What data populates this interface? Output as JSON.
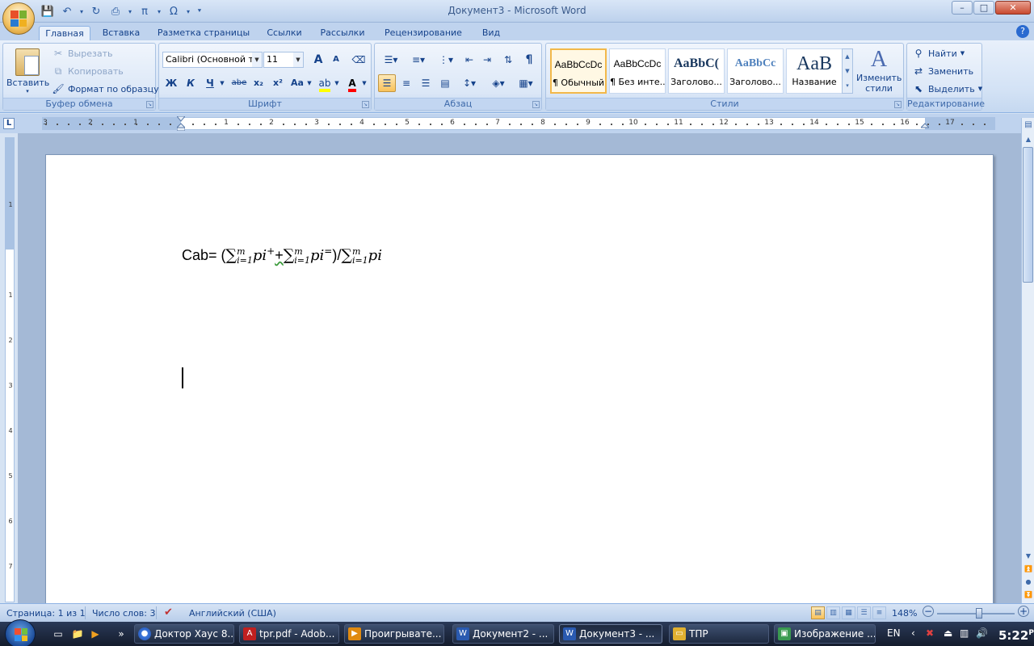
{
  "window": {
    "title": "Документ3 - Microsoft Word",
    "minimize": "–",
    "maximize": "□",
    "close": "✕"
  },
  "tabs": [
    "Главная",
    "Вставка",
    "Разметка страницы",
    "Ссылки",
    "Рассылки",
    "Рецензирование",
    "Вид"
  ],
  "active_tab": "Главная",
  "ribbon": {
    "clipboard": {
      "label": "Буфер обмена",
      "paste": "Вставить",
      "cut": "Вырезать",
      "copy": "Копировать",
      "format_painter": "Формат по образцу"
    },
    "font": {
      "label": "Шрифт",
      "font_name": "Calibri (Основной те",
      "font_size": "11",
      "bold": "Ж",
      "italic": "К",
      "underline": "Ч",
      "strike": "abe",
      "subscript": "x₂",
      "superscript": "x²",
      "change_case": "Aa",
      "grow": "A",
      "shrink": "A"
    },
    "paragraph": {
      "label": "Абзац",
      "pilcrow": "¶"
    },
    "styles": {
      "label": "Стили",
      "items": [
        {
          "sample": "AaBbCcDc",
          "name": "¶ Обычный"
        },
        {
          "sample": "AaBbCcDc",
          "name": "¶ Без инте..."
        },
        {
          "sample": "AaBbC(",
          "name": "Заголово..."
        },
        {
          "sample": "AaBbCc",
          "name": "Заголово..."
        },
        {
          "sample": "AaB",
          "name": "Название"
        }
      ],
      "change_styles": "Изменить стили"
    },
    "editing": {
      "label": "Редактирование",
      "find": "Найти",
      "replace": "Заменить",
      "select": "Выделить"
    }
  },
  "ruler": {
    "left_numbers": [
      "3",
      "2",
      "1"
    ],
    "right_numbers": [
      "1",
      "2",
      "3",
      "4",
      "5",
      "6",
      "7",
      "8",
      "9",
      "10",
      "11",
      "12",
      "13",
      "14",
      "15",
      "16",
      "17"
    ],
    "vertical_numbers": [
      "1",
      "1",
      "2",
      "3",
      "4",
      "5",
      "6",
      "7"
    ],
    "corner": "L"
  },
  "document": {
    "formula_prefix": "Cab= (",
    "sum_symbol": "∑",
    "limit_top": "m",
    "limit_bottom": "i=1",
    "term": "pi",
    "sup_plus": "+",
    "plus": "+",
    "sup_eq": "=",
    "close_div": ")/"
  },
  "statusbar": {
    "page": "Страница: 1 из 1",
    "words": "Число слов: 3",
    "language": "Английский (США)",
    "zoom": "148%",
    "zoom_minus": "−",
    "zoom_plus": "+"
  },
  "taskbar": {
    "items": [
      {
        "label": "Доктор Хаус 8...",
        "icon": "chrome-icon"
      },
      {
        "label": "tpr.pdf - Adob...",
        "icon": "pdf-icon"
      },
      {
        "label": "Проигрывате...",
        "icon": "media-player-icon"
      },
      {
        "label": "Документ2 - ...",
        "icon": "word-icon"
      },
      {
        "label": "Документ3 - ...",
        "icon": "word-icon"
      },
      {
        "label": "ТПР",
        "icon": "folder-icon"
      },
      {
        "label": "Изображение ...",
        "icon": "image-icon"
      }
    ],
    "lang": "EN",
    "time": "5:22",
    "ampm": "PM",
    "more": "»"
  }
}
